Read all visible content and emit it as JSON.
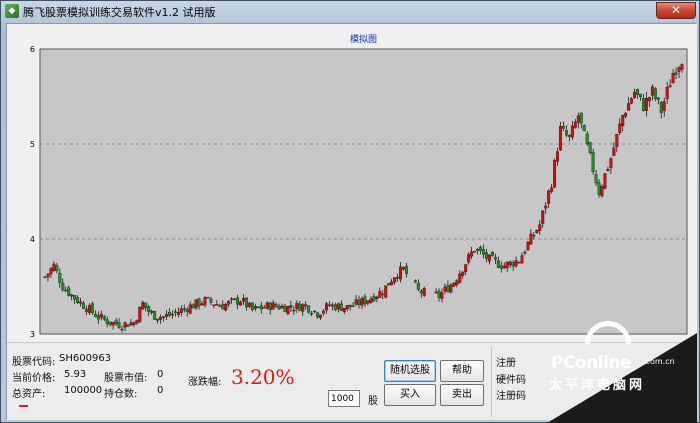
{
  "window": {
    "title": "腾飞股票模拟训练交易软件v1.2 试用版",
    "close_glyph": "✕",
    "icon": "app-stock-icon"
  },
  "chart": {
    "title": "模拟图"
  },
  "chart_data": {
    "type": "candlestick",
    "title": "模拟图",
    "xlabel": "",
    "ylabel": "",
    "ylim": [
      3,
      6
    ],
    "yticks": [
      3,
      4,
      5,
      6
    ],
    "grid": true,
    "colors": {
      "up": "#d01010",
      "down": "#1f8f1f",
      "background": "#c7c7c7",
      "title": "#1030c0"
    },
    "x_range": [
      0,
      215
    ],
    "gaps": [
      [
        122,
        125
      ],
      [
        128,
        132
      ]
    ],
    "keypoints": [
      [
        0,
        3.6
      ],
      [
        3,
        3.72
      ],
      [
        6,
        3.5
      ],
      [
        10,
        3.38
      ],
      [
        14,
        3.28
      ],
      [
        18,
        3.18
      ],
      [
        22,
        3.12
      ],
      [
        26,
        3.1
      ],
      [
        30,
        3.12
      ],
      [
        33,
        3.32
      ],
      [
        36,
        3.2
      ],
      [
        40,
        3.18
      ],
      [
        44,
        3.22
      ],
      [
        48,
        3.28
      ],
      [
        54,
        3.35
      ],
      [
        60,
        3.3
      ],
      [
        66,
        3.36
      ],
      [
        70,
        3.25
      ],
      [
        76,
        3.3
      ],
      [
        82,
        3.28
      ],
      [
        88,
        3.3
      ],
      [
        92,
        3.22
      ],
      [
        96,
        3.3
      ],
      [
        102,
        3.28
      ],
      [
        108,
        3.35
      ],
      [
        114,
        3.45
      ],
      [
        118,
        3.62
      ],
      [
        121,
        3.68
      ],
      [
        126,
        3.45
      ],
      [
        133,
        3.4
      ],
      [
        138,
        3.55
      ],
      [
        142,
        3.75
      ],
      [
        145,
        3.9
      ],
      [
        150,
        3.78
      ],
      [
        155,
        3.72
      ],
      [
        160,
        3.78
      ],
      [
        163,
        3.95
      ],
      [
        167,
        4.15
      ],
      [
        171,
        4.6
      ],
      [
        174,
        5.15
      ],
      [
        177,
        5.05
      ],
      [
        180,
        5.3
      ],
      [
        184,
        4.85
      ],
      [
        187,
        4.5
      ],
      [
        191,
        4.85
      ],
      [
        195,
        5.3
      ],
      [
        199,
        5.55
      ],
      [
        202,
        5.4
      ],
      [
        205,
        5.55
      ],
      [
        208,
        5.35
      ],
      [
        212,
        5.75
      ],
      [
        215,
        5.9
      ]
    ]
  },
  "info": {
    "stock_code_label": "股票代码:",
    "stock_code_value": "SH600963",
    "current_price_label": "当前价格:",
    "current_price_value": "5.93",
    "market_value_label": "股票市值:",
    "market_value_value": "0",
    "total_assets_label": "总资产:",
    "total_assets_value": "100000",
    "holding_label": "持仓数:",
    "holding_value": "0",
    "change_label": "涨跌幅:",
    "change_value": "3.20%"
  },
  "trade": {
    "random_pick_label": "随机选股",
    "help_label": "帮助",
    "buy_label": "买入",
    "sell_label": "卖出",
    "quantity_value": "1000",
    "unit_label": "股"
  },
  "registration": {
    "register_label": "注册",
    "hardware_code_label": "硬件码",
    "register_code_label": "注册码"
  },
  "watermark": {
    "brand": "PConline",
    "domain": ".com.cn",
    "cn": "太平洋电脑网"
  }
}
